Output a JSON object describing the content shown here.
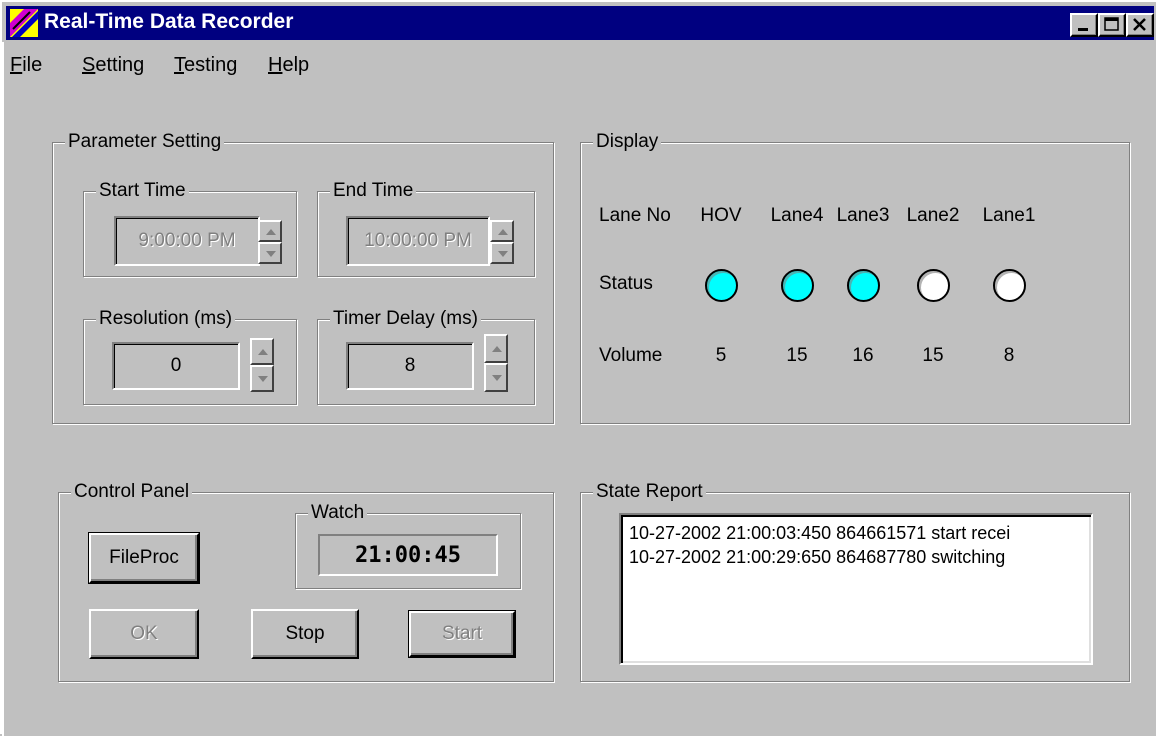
{
  "window": {
    "title": "Real-Time Data Recorder",
    "titlebar_color": "#000080"
  },
  "menu": [
    {
      "label": "File",
      "accel": "F"
    },
    {
      "label": "Setting",
      "accel": "S"
    },
    {
      "label": "Testing",
      "accel": "T"
    },
    {
      "label": "Help",
      "accel": "H"
    }
  ],
  "parameter_setting": {
    "title": "Parameter Setting",
    "start_time": {
      "label": "Start Time",
      "value": "9:00:00 PM"
    },
    "end_time": {
      "label": "End Time",
      "value": "10:00:00 PM"
    },
    "resolution": {
      "label": "Resolution (ms)",
      "value": "0"
    },
    "timer_delay": {
      "label": "Timer Delay (ms)",
      "value": "8"
    }
  },
  "display": {
    "title": "Display",
    "row_labels": {
      "lane": "Lane No",
      "status": "Status",
      "volume": "Volume"
    },
    "lanes": [
      {
        "name": "HOV",
        "status": "active",
        "volume": "5"
      },
      {
        "name": "Lane4",
        "status": "active",
        "volume": "15"
      },
      {
        "name": "Lane3",
        "status": "active",
        "volume": "16"
      },
      {
        "name": "Lane2",
        "status": "inactive",
        "volume": "15"
      },
      {
        "name": "Lane1",
        "status": "inactive",
        "volume": "8"
      }
    ],
    "colors": {
      "active": "#00ffff",
      "inactive": "#ffffff"
    }
  },
  "control_panel": {
    "title": "Control Panel",
    "fileproc_label": "FileProc",
    "watch_label": "Watch",
    "watch_time": "21:00:45",
    "ok_label": "OK",
    "stop_label": "Stop",
    "start_label": "Start"
  },
  "state_report": {
    "title": "State Report",
    "lines": [
      "10-27-2002 21:00:03:450 864661571 start recei",
      "10-27-2002 21:00:29:650 864687780 switching"
    ]
  }
}
